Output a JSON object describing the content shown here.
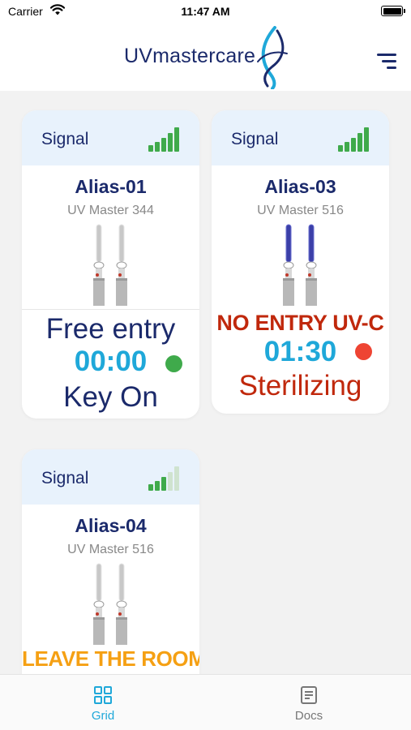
{
  "status_bar": {
    "carrier": "Carrier",
    "time": "11:47 AM"
  },
  "header": {
    "brand": "UVmastercare"
  },
  "devices": [
    {
      "signal_label": "Signal",
      "signal_bars_lit": 5,
      "alias": "Alias-01",
      "model": "UV Master 344",
      "lamp_state": "off",
      "state_text": "Free entry",
      "state_color": "#1b2a6b",
      "timer": "00:00",
      "indicator_color": "#3faa4b",
      "status_text": "Key On",
      "status_color": "#1b2a6b"
    },
    {
      "signal_label": "Signal",
      "signal_bars_lit": 5,
      "alias": "Alias-03",
      "model": "UV Master 516",
      "lamp_state": "on",
      "state_text": "NO ENTRY UV-C",
      "state_color": "#c0280c",
      "timer": "01:30",
      "indicator_color": "#ee4433",
      "status_text": "Sterilizing",
      "status_color": "#c0280c"
    },
    {
      "signal_label": "Signal",
      "signal_bars_lit": 3,
      "alias": "Alias-04",
      "model": "UV Master 516",
      "lamp_state": "off",
      "state_text": "LEAVE THE ROOM",
      "state_color": "#f5a013"
    }
  ],
  "tabs": [
    {
      "label": "Grid",
      "icon": "grid-icon",
      "active": true
    },
    {
      "label": "Docs",
      "icon": "docs-icon",
      "active": false
    }
  ],
  "colors": {
    "accent": "#1fa8d9",
    "brand": "#1b2a6b",
    "signal": "#3faa4b",
    "signal_off": "#cfe3cf"
  }
}
